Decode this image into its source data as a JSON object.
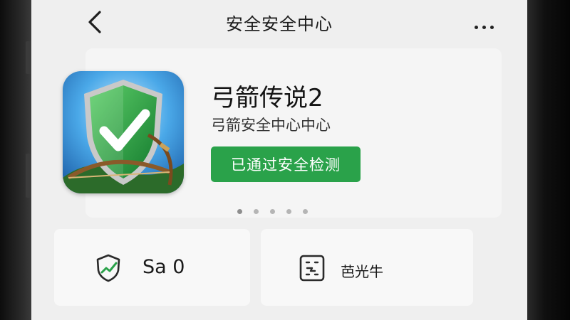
{
  "header": {
    "title": "安全安全中心"
  },
  "app": {
    "name": "弓箭传说2",
    "subtitle": "弓箭安全中心中心",
    "status_button": "已通过安全检测"
  },
  "carousel": {
    "page_count": 5,
    "active_index": 0
  },
  "tiles": {
    "left": {
      "icon": "shield-check-icon",
      "label": "Sa 0"
    },
    "right": {
      "icon": "scan-frame-icon",
      "label": "芭光牛"
    }
  },
  "colors": {
    "accent_green": "#2aa24a",
    "background": "#efefef"
  }
}
